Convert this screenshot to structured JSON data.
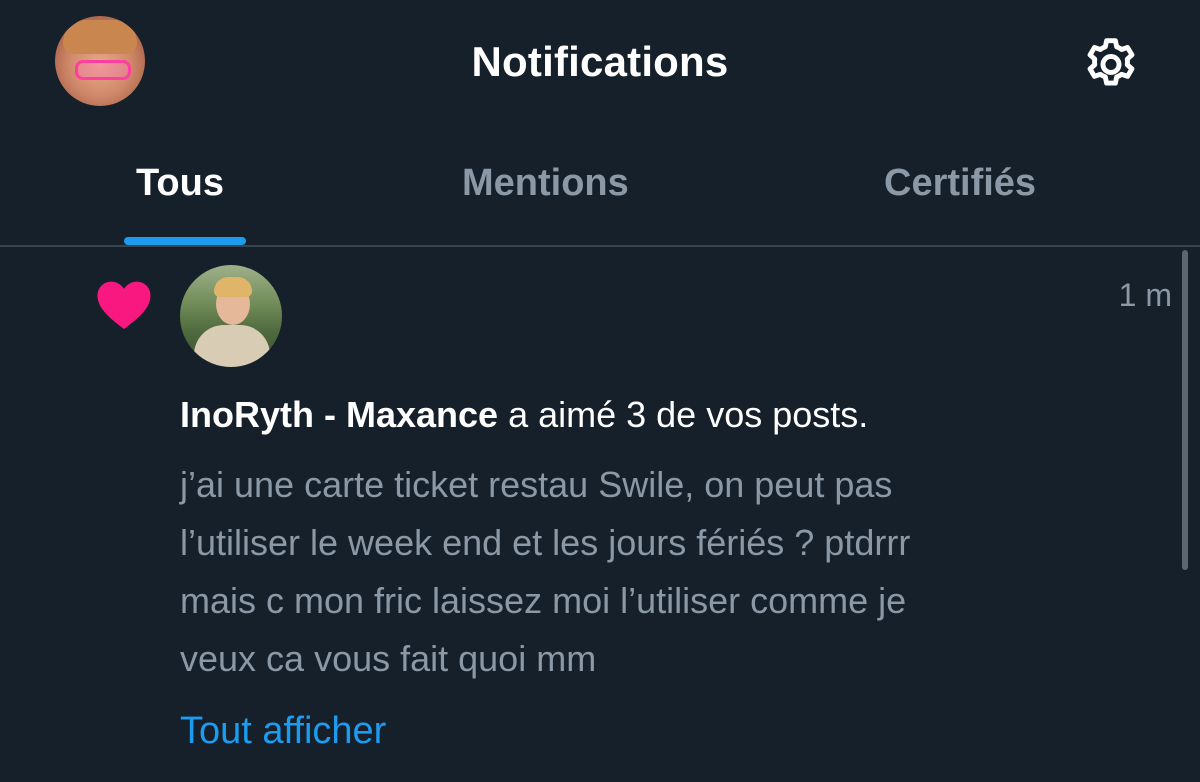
{
  "header": {
    "title": "Notifications",
    "avatar_icon": "profile-avatar",
    "settings_icon": "gear-icon"
  },
  "tabs": [
    {
      "label": "Tous",
      "active": true
    },
    {
      "label": "Mentions",
      "active": false
    },
    {
      "label": "Certifiés",
      "active": false
    }
  ],
  "notification": {
    "icon": "heart-icon",
    "icon_color": "#f91880",
    "time": "1 m",
    "user_name": "InoRyth - Maxance",
    "action_text": " a aimé 3 de vos posts.",
    "post_lines": [
      "j’ai une carte ticket restau Swile, on peut pas",
      "l’utiliser le week end et les jours fériés ? ptdrrr",
      "mais c mon fric laissez moi l’utiliser comme je",
      "veux ca vous fait quoi mm"
    ],
    "show_all_label": "Tout afficher"
  },
  "colors": {
    "background": "#15202b",
    "accent": "#1d9bf0",
    "muted_text": "#8b98a5",
    "like": "#f91880"
  }
}
